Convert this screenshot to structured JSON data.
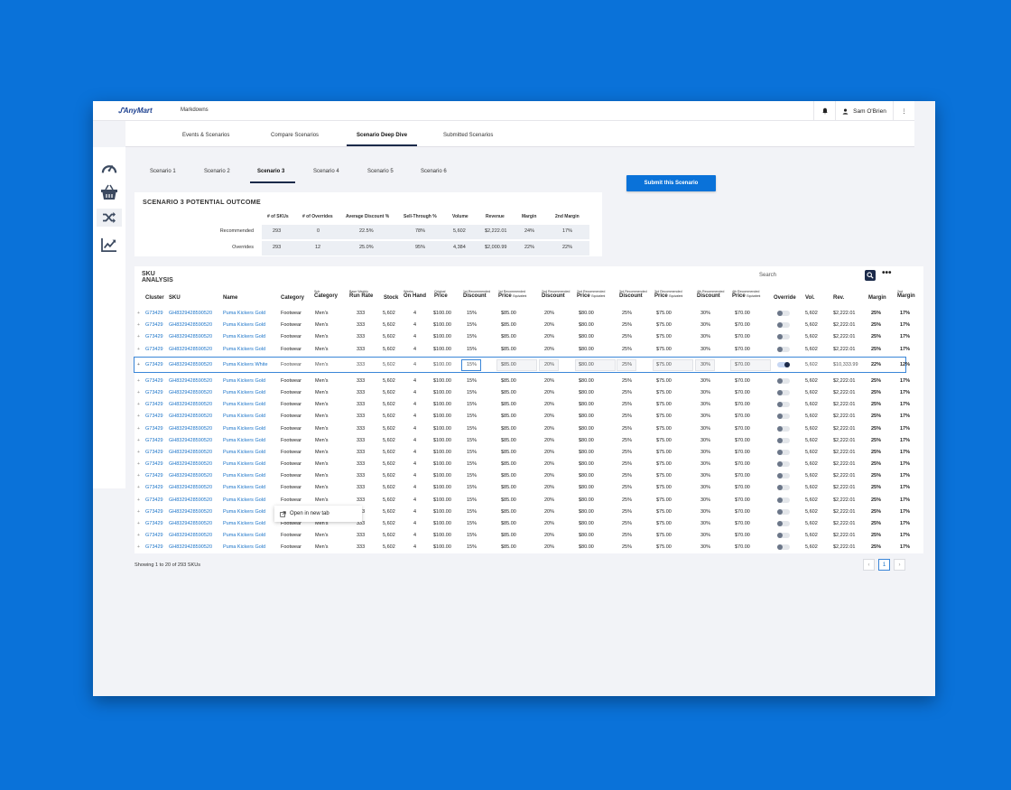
{
  "app": {
    "logo_text": "AnyMart",
    "menu_label": "Markdowns",
    "user_name": "Sam O'Brien"
  },
  "top_tabs": [
    {
      "label": "Events & Scenarios"
    },
    {
      "label": "Compare Scenarios"
    },
    {
      "label": "Scenario Deep Dive",
      "active": true
    },
    {
      "label": "Submitted Scenarios"
    }
  ],
  "sidebar_icons": [
    "dashboard-gauge-icon",
    "basket-icon",
    "shuffle-icon",
    "trend-chart-icon"
  ],
  "scenario_tabs": [
    {
      "label": "Scenario 1"
    },
    {
      "label": "Scenario 2"
    },
    {
      "label": "Scenario 3",
      "active": true
    },
    {
      "label": "Scenario 4"
    },
    {
      "label": "Scenario 5"
    },
    {
      "label": "Scenario 6"
    }
  ],
  "submit_button": "Submit this Scenario",
  "outcome": {
    "title": "SCENARIO 3 POTENTIAL OUTCOME",
    "headers": [
      "# of SKUs",
      "# of Overrides",
      "Average Discount %",
      "Sell-Through %",
      "Volume",
      "Revenue",
      "Margin",
      "2nd Margin"
    ],
    "rows": [
      {
        "label": "Recommended",
        "values": [
          "293",
          "0",
          "22.5%",
          "78%",
          "5,602",
          "$2,222.01",
          "24%",
          "17%"
        ]
      },
      {
        "label": "Overrides",
        "values": [
          "293",
          "12",
          "25.0%",
          "95%",
          "4,384",
          "$2,000.99",
          "22%",
          "22%"
        ]
      }
    ]
  },
  "sku": {
    "title_line1": "SKU",
    "title_line2": "ANALYSIS",
    "search_placeholder": "Search",
    "more_label": "•••",
    "columns": [
      {
        "sub": "",
        "label": "Cluster"
      },
      {
        "sub": "",
        "label": "SKU"
      },
      {
        "sub": "",
        "label": "Name"
      },
      {
        "sub": "",
        "label": "Category"
      },
      {
        "sub": "Sub",
        "label": "Category"
      },
      {
        "sub": "Base Weekly",
        "label": "Run Rate"
      },
      {
        "sub": "",
        "label": "Stock"
      },
      {
        "sub": "Weeks",
        "label": "On Hand"
      },
      {
        "sub": "Original",
        "label": "Price"
      },
      {
        "sub": "1st Recommended",
        "label": "Discount"
      },
      {
        "sub": "1st Recommended",
        "label": "Price",
        "suffix": "Equivalent"
      },
      {
        "sub": "2nd Recommended",
        "label": "Discount"
      },
      {
        "sub": "2nd Recommended",
        "label": "Price",
        "suffix": "Equivalent"
      },
      {
        "sub": "3rd Recommended",
        "label": "Discount"
      },
      {
        "sub": "3rd Recommended",
        "label": "Price",
        "suffix": "Equivalent"
      },
      {
        "sub": "4th Recommended",
        "label": "Discount"
      },
      {
        "sub": "4th Recommended",
        "label": "Price",
        "suffix": "Equivalent"
      },
      {
        "sub": "",
        "label": "Override"
      },
      {
        "sub": "",
        "label": "Vol."
      },
      {
        "sub": "",
        "label": "Rev."
      },
      {
        "sub": "",
        "label": "Margin"
      },
      {
        "sub": "2nd",
        "label": "Margin"
      }
    ],
    "standard_row": {
      "plus": "+",
      "cluster": "G73429",
      "sku": "GH8329428590520",
      "name": "Puma Kickers Gold",
      "category": "Footwear",
      "subcategory": "Men's",
      "run_rate": "333",
      "stock": "5,602",
      "weeks": "4",
      "price": "$100.00",
      "d1": "15%",
      "p1": "$85.00",
      "d2": "20%",
      "p2": "$80.00",
      "d3": "25%",
      "p3": "$75.00",
      "d4": "30%",
      "p4": "$70.00",
      "override": false,
      "vol": "5,602",
      "rev": "$2,222.01",
      "margin": "25%",
      "margin2": "17%"
    },
    "selected_row": {
      "plus": "+",
      "cluster": "G73429",
      "sku": "GH8329428590520",
      "name": "Puma Kickers White",
      "category": "Footwear",
      "subcategory": "Men's",
      "run_rate": "333",
      "stock": "5,602",
      "weeks": "4",
      "price": "$100.00",
      "d1": "15%",
      "p1": "$85.00",
      "d2": "20%",
      "p2": "$80.00",
      "d3": "25%",
      "p3": "$75.00",
      "d4": "30%",
      "p4": "$70.00",
      "override": true,
      "vol": "5,602",
      "rev": "$10,333.99",
      "margin": "22%",
      "margin2": "12%"
    },
    "context_menu_label": "Open in new tab",
    "footer": "Showing 1 to 20 of 293 SKUs",
    "pagination": {
      "prev": "‹",
      "current": "1",
      "next": "›"
    }
  },
  "colors": {
    "background": "#0a72d9",
    "accent": "#0a72d9",
    "navy": "#1b2a4a",
    "link": "#1a73c8"
  }
}
